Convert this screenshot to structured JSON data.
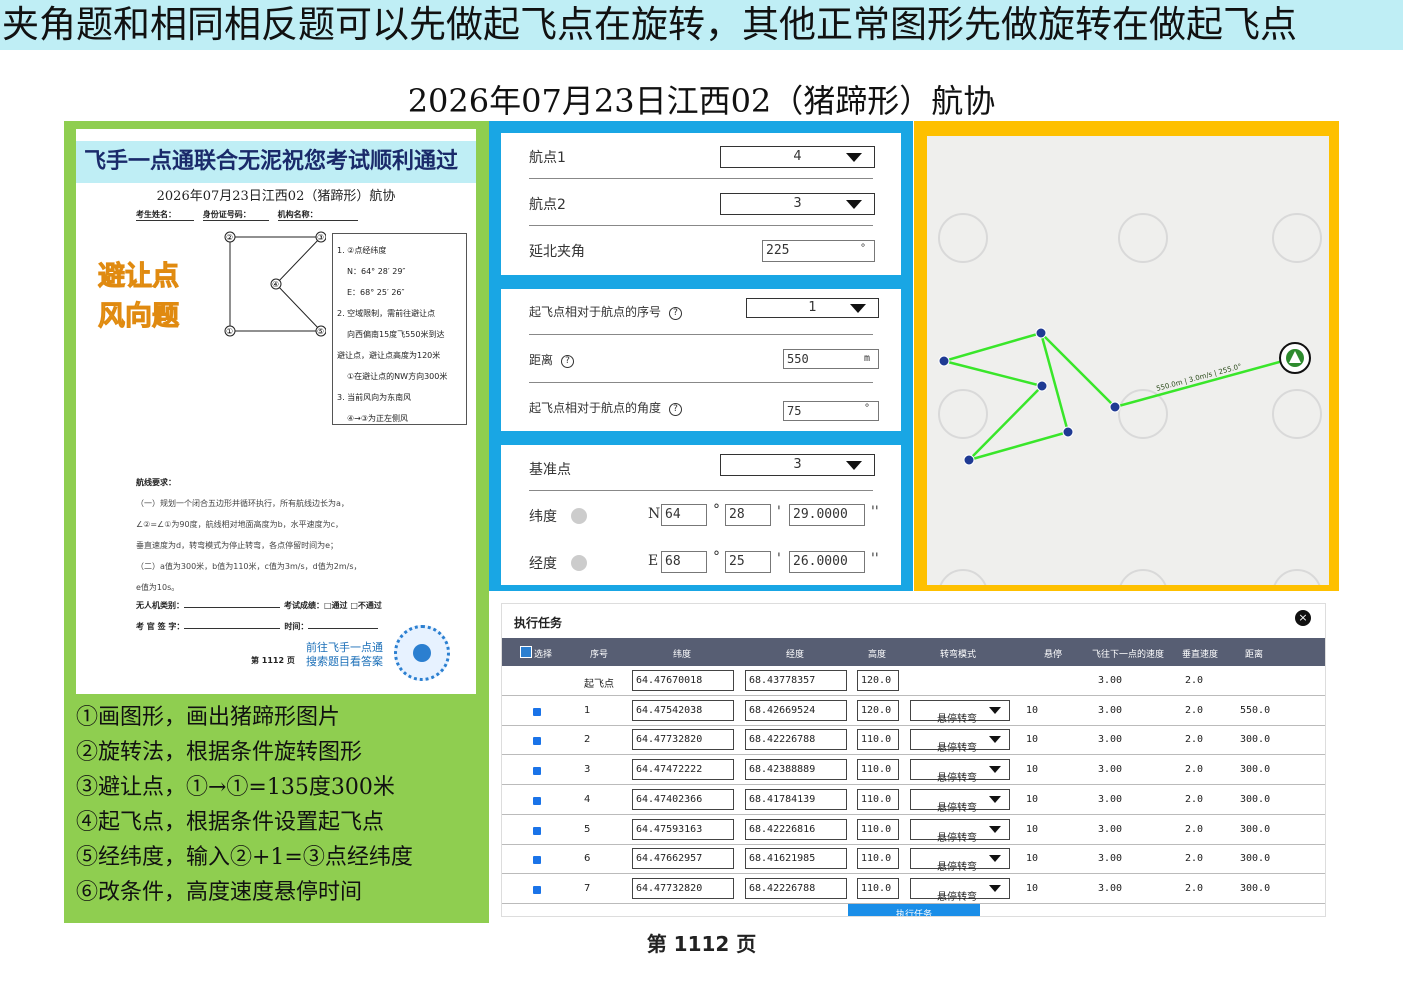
{
  "banner": "夹角题和相同相反题可以先做起飞点在旋转，其他正常图形先做旋转在做起飞点",
  "title": "2026年07月23日江西02（猪蹄形）航协",
  "doc": {
    "header": "飞手一点通联合无泥祝您考试顺利通过",
    "subtitle": "2026年07月23日江西02（猪蹄形）航协",
    "field_name": "考生姓名：",
    "field_id": "身份证号码：",
    "field_org": "机构名称：",
    "tag1": "避让点",
    "tag2": "风向题",
    "points": [
      "②",
      "③",
      "④",
      "①",
      "⑤"
    ],
    "conditions": [
      "1. ②点经纬度",
      "N：64° 28′ 29″",
      "E：68° 25′ 26″",
      "2. 空域限制，需前往避让点",
      "向西偏南15度飞550米到达",
      "避让点，避让点高度为120米",
      "①在避让点的NW方向300米",
      "3. 当前风向为东南风",
      "④→③为正左侧风"
    ],
    "req_title": "航线要求：",
    "req_lines": [
      "（一）规划一个闭合五边形并循环执行，所有航线边长为a，",
      "∠②=∠①为90度，航线相对地面高度为b，水平速度为c，",
      "垂直速度为d，转弯模式为停止转弯，各点停留时间为e；",
      "（二）a值为300米，b值为110米，c值为3m/s，d值为2m/s，",
      "e值为10s。"
    ],
    "sign1": "无人机类别：",
    "sign1b": "考试成绩：□通过  □不通过",
    "sign2": "考 官 签 字：",
    "sign2b": "时间：",
    "promo1": "前往飞手一点通",
    "promo2": "搜索题目看答案",
    "page": "第 1112 页"
  },
  "steps": [
    "①画图形，画出猪蹄形图片",
    "②旋转法，根据条件旋转图形",
    "③避让点，①→①=135度300米",
    "④起飞点，根据条件设置起飞点",
    "⑤经纬度，输入②+1=③点经纬度",
    "⑥改条件，高度速度悬停时间"
  ],
  "settings": {
    "waypoint1_label": "航点1",
    "waypoint1_value": "4",
    "waypoint2_label": "航点2",
    "waypoint2_value": "3",
    "angle_label": "延北夹角",
    "angle_value": "225",
    "deg": "°",
    "takeoff_index_label": "起飞点相对于航点的序号",
    "takeoff_index_value": "1",
    "distance_label": "距离",
    "distance_value": "550",
    "distance_unit": "m",
    "takeoff_angle_label": "起飞点相对于航点的角度",
    "takeoff_angle_value": "75",
    "base_label": "基准点",
    "base_value": "3",
    "lat_label": "纬度",
    "lat_hemi": "N",
    "lat_deg": "64",
    "lat_min": "28",
    "lat_sec": "29.0000",
    "lon_label": "经度",
    "lon_hemi": "E",
    "lon_deg": "68",
    "lon_min": "25",
    "lon_sec": "26.0000",
    "sym_deg": "°",
    "sym_min": "'",
    "sym_sec": "''"
  },
  "map": {
    "takeoff_label": "550.0m | 3.0m/s | 255.0°",
    "route_color": "#39e62a"
  },
  "task": {
    "title": "执行任务",
    "close": "×",
    "headers": [
      "选择",
      "序号",
      "纬度",
      "经度",
      "高度",
      "转弯模式",
      "悬停",
      "飞往下一点的速度",
      "垂直速度",
      "距离"
    ],
    "rows": [
      {
        "seq": "起飞点",
        "lat": "64.47670018",
        "lon": "68.43778357",
        "alt": "120.0",
        "turn": "",
        "hover": "",
        "speed": "3.00",
        "vspeed": "2.0",
        "dist": "",
        "check": false
      },
      {
        "seq": "1",
        "lat": "64.47542038",
        "lon": "68.42669524",
        "alt": "120.0",
        "turn": "悬停转弯",
        "hover": "10",
        "speed": "3.00",
        "vspeed": "2.0",
        "dist": "550.0",
        "check": true
      },
      {
        "seq": "2",
        "lat": "64.47732820",
        "lon": "68.42226788",
        "alt": "110.0",
        "turn": "悬停转弯",
        "hover": "10",
        "speed": "3.00",
        "vspeed": "2.0",
        "dist": "300.0",
        "check": true
      },
      {
        "seq": "3",
        "lat": "64.47472222",
        "lon": "68.42388889",
        "alt": "110.0",
        "turn": "悬停转弯",
        "hover": "10",
        "speed": "3.00",
        "vspeed": "2.0",
        "dist": "300.0",
        "check": true
      },
      {
        "seq": "4",
        "lat": "64.47402366",
        "lon": "68.41784139",
        "alt": "110.0",
        "turn": "悬停转弯",
        "hover": "10",
        "speed": "3.00",
        "vspeed": "2.0",
        "dist": "300.0",
        "check": true
      },
      {
        "seq": "5",
        "lat": "64.47593163",
        "lon": "68.42226816",
        "alt": "110.0",
        "turn": "悬停转弯",
        "hover": "10",
        "speed": "3.00",
        "vspeed": "2.0",
        "dist": "300.0",
        "check": true
      },
      {
        "seq": "6",
        "lat": "64.47662957",
        "lon": "68.41621985",
        "alt": "110.0",
        "turn": "悬停转弯",
        "hover": "10",
        "speed": "3.00",
        "vspeed": "2.0",
        "dist": "300.0",
        "check": true
      },
      {
        "seq": "7",
        "lat": "64.47732820",
        "lon": "68.42226788",
        "alt": "110.0",
        "turn": "悬停转弯",
        "hover": "10",
        "speed": "3.00",
        "vspeed": "2.0",
        "dist": "300.0",
        "check": true
      }
    ],
    "execute": "执行任务"
  },
  "footer": "第 1112 页"
}
